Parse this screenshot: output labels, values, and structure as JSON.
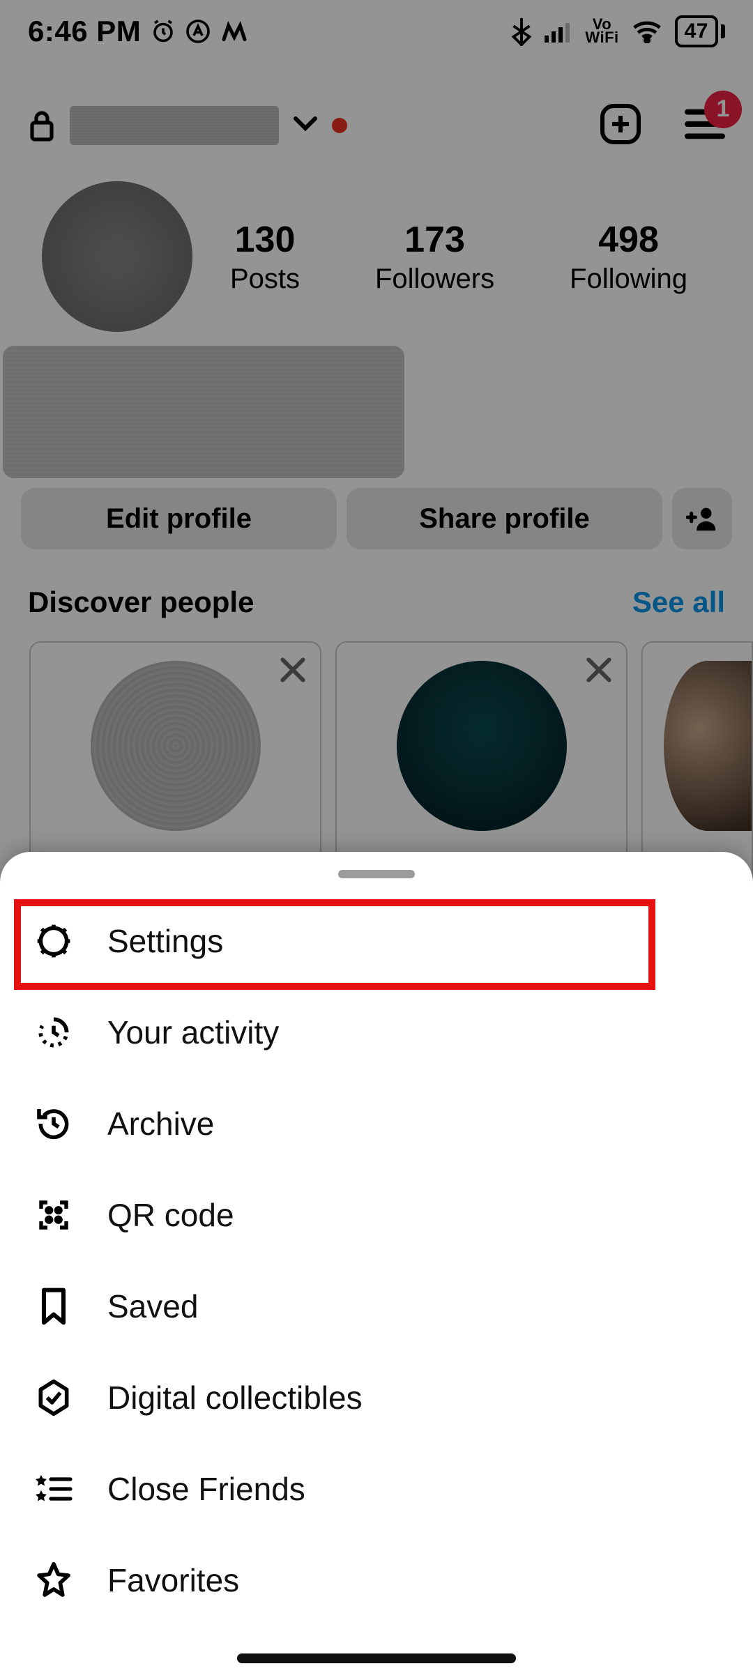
{
  "status": {
    "time": "6:46 PM",
    "battery": "47",
    "vo": "Vo",
    "wifi_label": "WiFi"
  },
  "header": {
    "badge_count": "1"
  },
  "stats": {
    "posts_num": "130",
    "posts_label": "Posts",
    "followers_num": "173",
    "followers_label": "Followers",
    "following_num": "498",
    "following_label": "Following"
  },
  "actions": {
    "edit": "Edit profile",
    "share": "Share profile"
  },
  "discover": {
    "title": "Discover people",
    "see_all": "See all"
  },
  "menu": {
    "settings": "Settings",
    "activity": "Your activity",
    "archive": "Archive",
    "qr": "QR code",
    "saved": "Saved",
    "digital": "Digital collectibles",
    "close_friends": "Close Friends",
    "favorites": "Favorites"
  }
}
